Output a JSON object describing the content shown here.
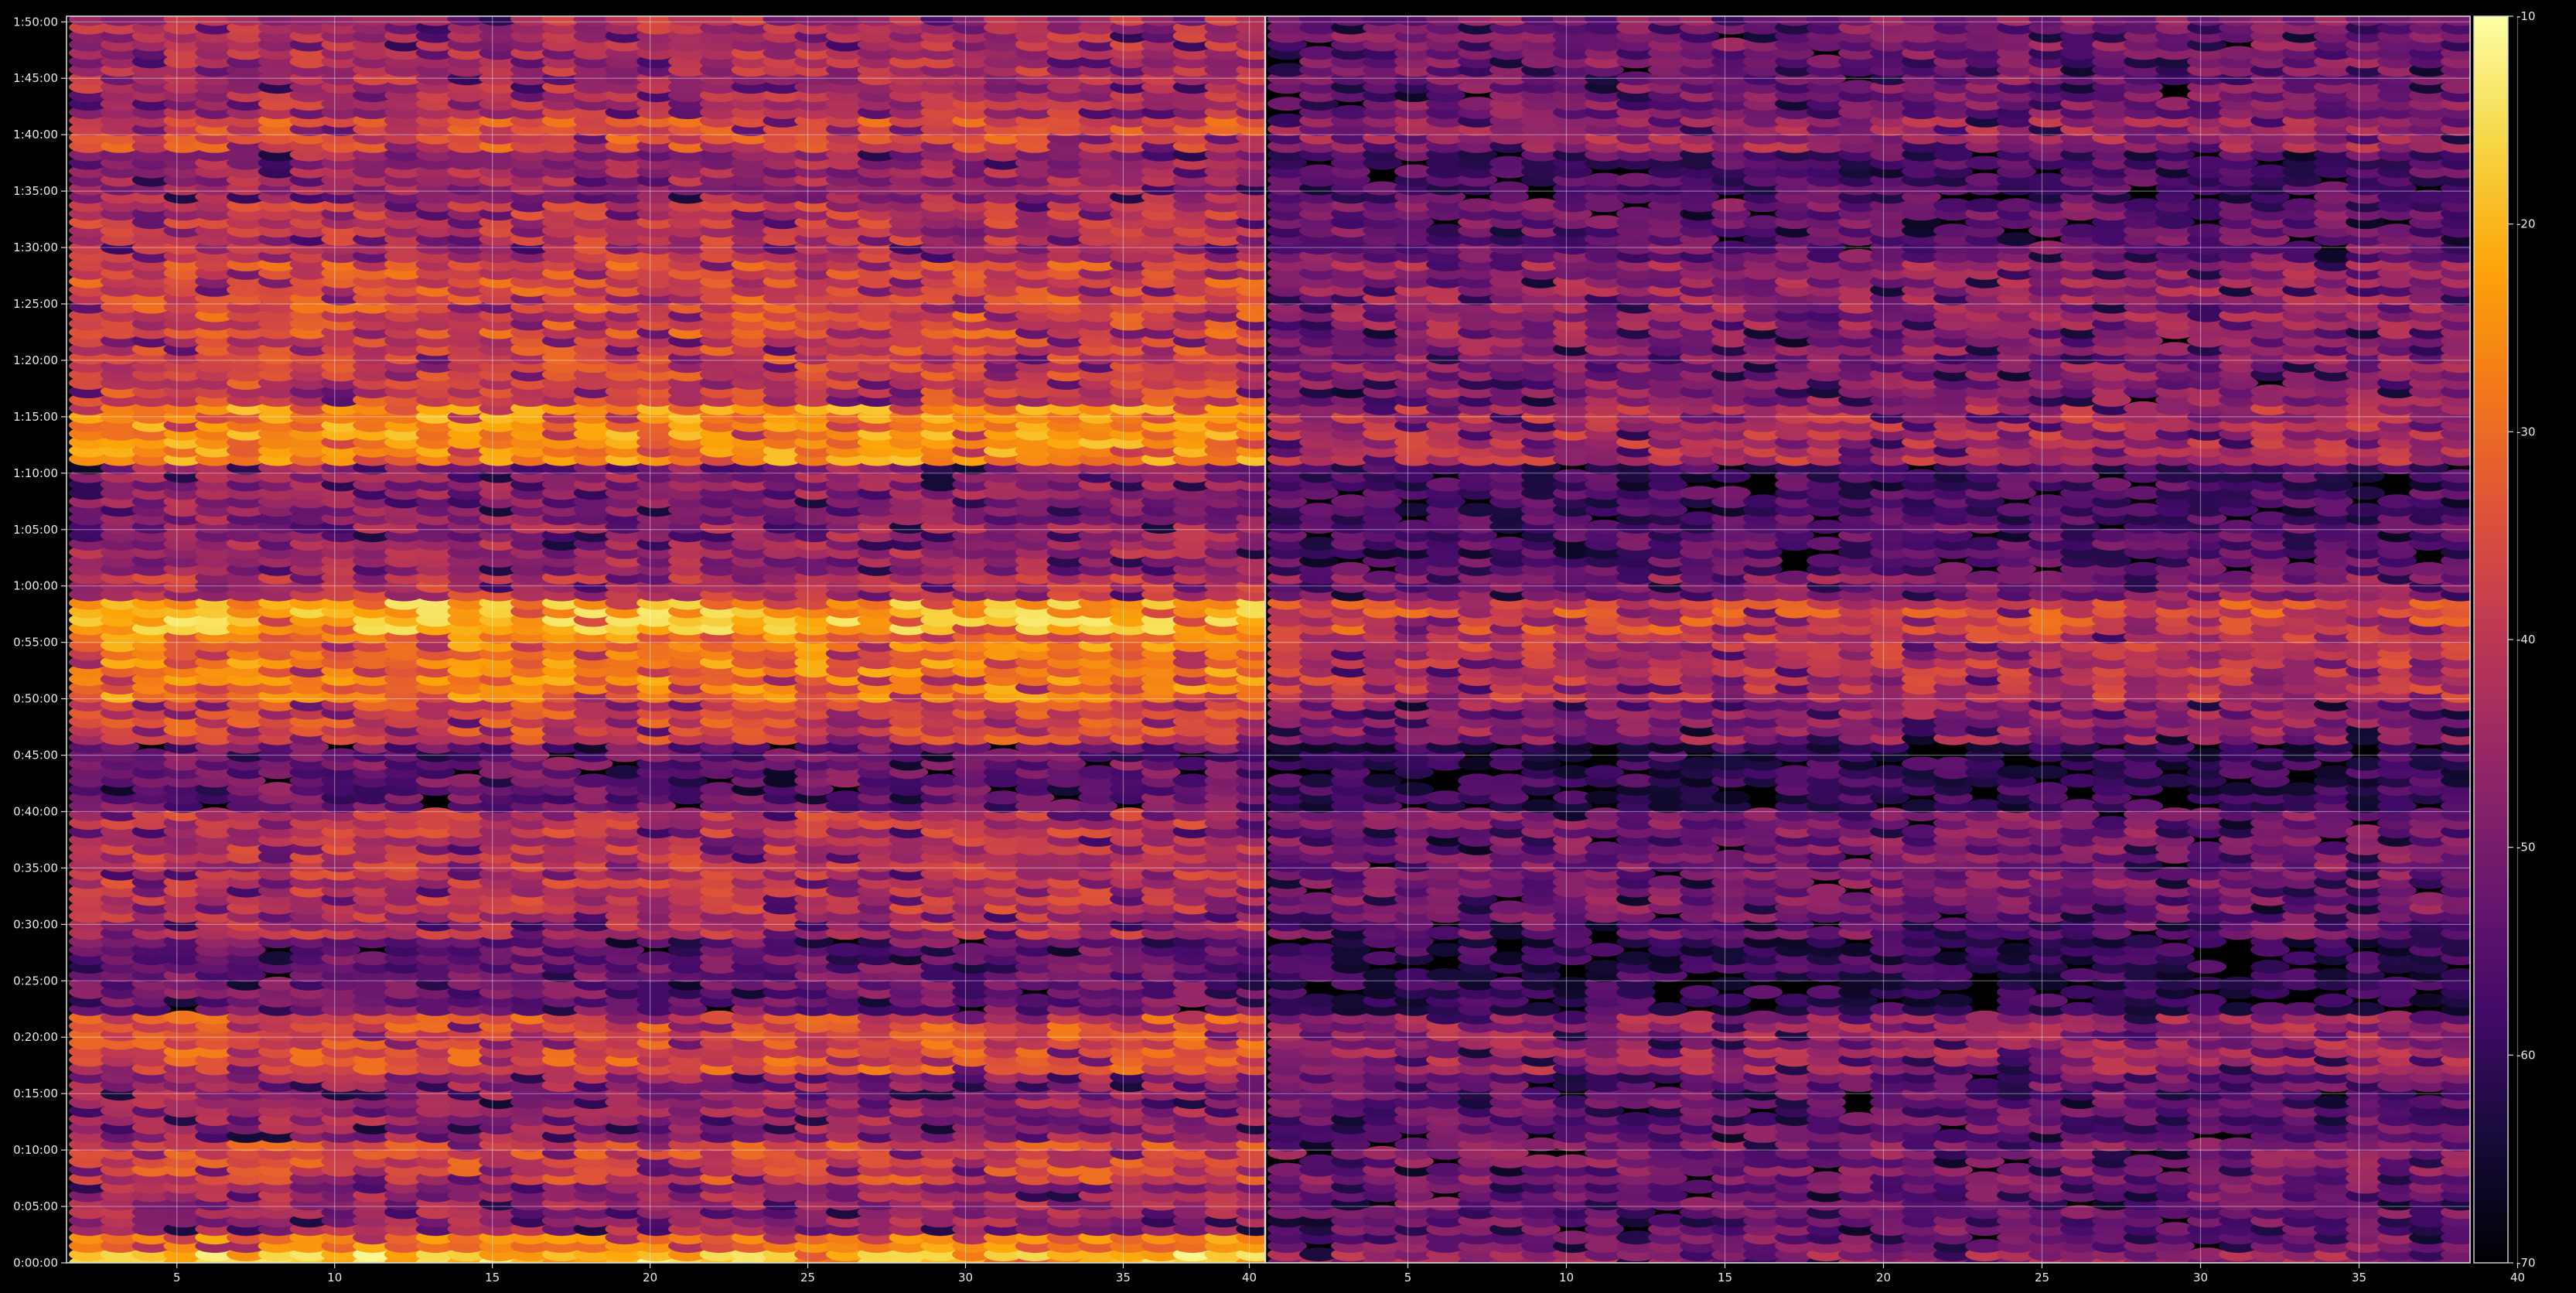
{
  "chart_data": {
    "type": "heatmap",
    "title": "",
    "xlabel": "",
    "ylabel": "",
    "grid": true,
    "colormap": "inferno",
    "panels": [
      {
        "name": "",
        "x_range": [
          1.5,
          39.5
        ],
        "x_ticks": [
          "5",
          "10",
          "15",
          "20",
          "25",
          "30",
          "35"
        ]
      },
      {
        "name": "",
        "x_range": [
          40.5,
          78.5
        ],
        "x_ticks": [
          "40",
          "5",
          "10",
          "15",
          "20",
          "25",
          "30",
          "35",
          "40"
        ]
      }
    ],
    "y_ticks": [
      "0:00:00",
      "0:05:00",
      "0:10:00",
      "0:15:00",
      "0:20:00",
      "0:25:00",
      "0:30:00",
      "0:35:00",
      "0:40:00",
      "0:45:00",
      "0:50:00",
      "0:55:00",
      "1:00:00",
      "1:05:00",
      "1:10:00",
      "1:15:00",
      "1:20:00",
      "1:25:00",
      "1:30:00",
      "1:35:00",
      "1:40:00",
      "1:45:00",
      "1:50:00"
    ],
    "y_range_minutes": [
      0,
      110.5
    ],
    "columns": 38,
    "row_step_minutes": 0.75,
    "colorbar": {
      "min": -70,
      "max": -10,
      "ticks": [
        "-10",
        "-20",
        "-30",
        "-40",
        "-50",
        "-60",
        "-70"
      ]
    },
    "row_levels_dB": {
      "description": "estimated mean level per time band (minutes) for left / right panel",
      "bands": [
        {
          "from": 0,
          "to": 1,
          "left": -18,
          "right": -45
        },
        {
          "from": 1,
          "to": 3,
          "left": -27,
          "right": -50
        },
        {
          "from": 3,
          "to": 7,
          "left": -45,
          "right": -52
        },
        {
          "from": 7,
          "to": 11,
          "left": -36,
          "right": -50
        },
        {
          "from": 11,
          "to": 17,
          "left": -46,
          "right": -53
        },
        {
          "from": 17,
          "to": 22,
          "left": -34,
          "right": -45
        },
        {
          "from": 22,
          "to": 29,
          "left": -52,
          "right": -60
        },
        {
          "from": 29,
          "to": 31,
          "left": -42,
          "right": -52
        },
        {
          "from": 31,
          "to": 40,
          "left": -40,
          "right": -50
        },
        {
          "from": 40,
          "to": 46,
          "left": -52,
          "right": -60
        },
        {
          "from": 46,
          "to": 50,
          "left": -36,
          "right": -47
        },
        {
          "from": 50,
          "to": 56,
          "left": -27,
          "right": -40
        },
        {
          "from": 56,
          "to": 59,
          "left": -20,
          "right": -35
        },
        {
          "from": 59,
          "to": 61,
          "left": -40,
          "right": -48
        },
        {
          "from": 61,
          "to": 66,
          "left": -45,
          "right": -55
        },
        {
          "from": 66,
          "to": 71,
          "left": -47,
          "right": -57
        },
        {
          "from": 71,
          "to": 76,
          "left": -25,
          "right": -42
        },
        {
          "from": 76,
          "to": 82,
          "left": -37,
          "right": -48
        },
        {
          "from": 82,
          "to": 89,
          "left": -35,
          "right": -46
        },
        {
          "from": 89,
          "to": 94,
          "left": -40,
          "right": -52
        },
        {
          "from": 94,
          "to": 99,
          "left": -45,
          "right": -56
        },
        {
          "from": 99,
          "to": 102,
          "left": -35,
          "right": -45
        },
        {
          "from": 102,
          "to": 110.5,
          "left": -42,
          "right": -50
        }
      ]
    }
  }
}
